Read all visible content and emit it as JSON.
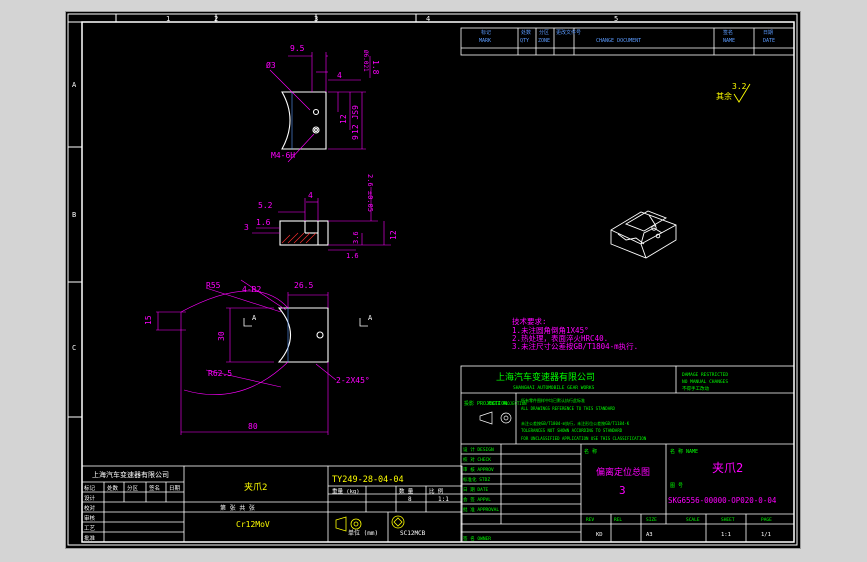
{
  "drawing": {
    "border_zones_top": [
      "1",
      "2",
      "3",
      "4",
      "5"
    ],
    "border_zones_left": [
      "A",
      "B",
      "C"
    ],
    "revision_table": {
      "headers_cn": [
        "标记",
        "处数",
        "分区",
        "更改文件号",
        "签名",
        "日期"
      ],
      "headers_en": [
        "MARK",
        "QTY",
        "ZONE",
        "CHANGE DOCUMENT",
        "NAME",
        "DATE"
      ]
    },
    "roughness": {
      "value": "3.2",
      "label": "其余"
    },
    "technical_requirements": {
      "title": "技术要求:",
      "items": [
        "1.未注圆角倒角1X45°",
        "2.热处理，表面淬火HRC40.",
        "3.未注尺寸公差按GB/T1804-m执行."
      ]
    },
    "top_view": {
      "dims": [
        "9.5",
        "4",
        "Ø3",
        "1.8",
        "Ø6.021",
        "12 JS9",
        "12",
        "9",
        "M4-6H"
      ]
    },
    "section_view": {
      "dims": [
        "5.2",
        "4",
        "1.6",
        "3",
        "2.6 ±0.05",
        "3.6",
        "12",
        "1.6"
      ]
    },
    "front_view": {
      "dims": [
        "R55",
        "4-R2",
        "26.5",
        "15",
        "30",
        "R62.5",
        "2-2X45°",
        "80"
      ],
      "section_marks": [
        "A",
        "A"
      ]
    },
    "company_block": {
      "company_cn": "上海汽车变速器有限公司",
      "company_en": "SHANGHAI AUTOMOBILE GEAR WORKS",
      "damage_note": [
        "DAMAGE RESTRICTED",
        "NO MANUAL CHANGES",
        "不得手工改动"
      ],
      "projection_label": "投影 PROJECTION",
      "projection_en": "ANGLE PROJECTION",
      "notes": [
        "所有零件图样中均已默认执行此标准",
        "ALL DRAWINGS REFERENCE TO THIS STANDARD",
        "未注公差按GB/T1804-m执行，未注形位公差按GB/T1184-K",
        "TOLERANCES NOT SHOWN ACCORDING TO STANDARD",
        "FOR UNCLASSIFIED APPLICATION USE THIS CLASSIFICATION"
      ],
      "signature_rows": [
        "设 计 DESIGN",
        "校 对 CHECK",
        "审 核 APPROV",
        "标准化 STDZ",
        "日 期 DATE",
        "会 签 APPVL",
        "批 准 APPROVAL",
        "签 名 OWNER"
      ],
      "assembly_label": "名 称",
      "assembly_title": "偏离定位总图",
      "assembly_no": "3",
      "part_label": "名 称 NAME",
      "part_name": "夹爪2",
      "drawing_no_label": "图 号",
      "drawing_no": "SKG6556-00000-OP020-0-04",
      "footer_labels": [
        "REV",
        "REL",
        "SIZE",
        "SCALE",
        "SHEET",
        "PAGE"
      ],
      "footer_values": [
        "KD",
        "A3",
        "1:1",
        "1/1"
      ]
    },
    "local_title_block": {
      "company": "上海汽车变速器有限公司",
      "part_name": "夹爪2",
      "drawing_no": "TY249-28-04-04",
      "sheet_text": "第 张 共 张",
      "weight_label": "重量 (kg)",
      "quantity_label": "数 量",
      "scale_label": "比 例",
      "scale_value": "1:1",
      "quantity_value": "8",
      "material": "Cr12MoV",
      "unit_label": "单位 (mm)",
      "code": "SC12MCB",
      "left_rows": [
        "标记",
        "设计",
        "校对",
        "审核",
        "工艺",
        "批准"
      ],
      "left_col_labels": [
        "处数",
        "分区",
        "签名",
        "日期"
      ]
    }
  },
  "colors": {
    "background": "#000000",
    "frame": "#ffffff",
    "outline": "#ffffff",
    "dimension": "#ff00ff",
    "text_green": "#00ff00",
    "text_yellow": "#ffff00",
    "text_blue": "#5b9bff",
    "text_cyan": "#00ffff",
    "text_red": "#ff3030"
  }
}
